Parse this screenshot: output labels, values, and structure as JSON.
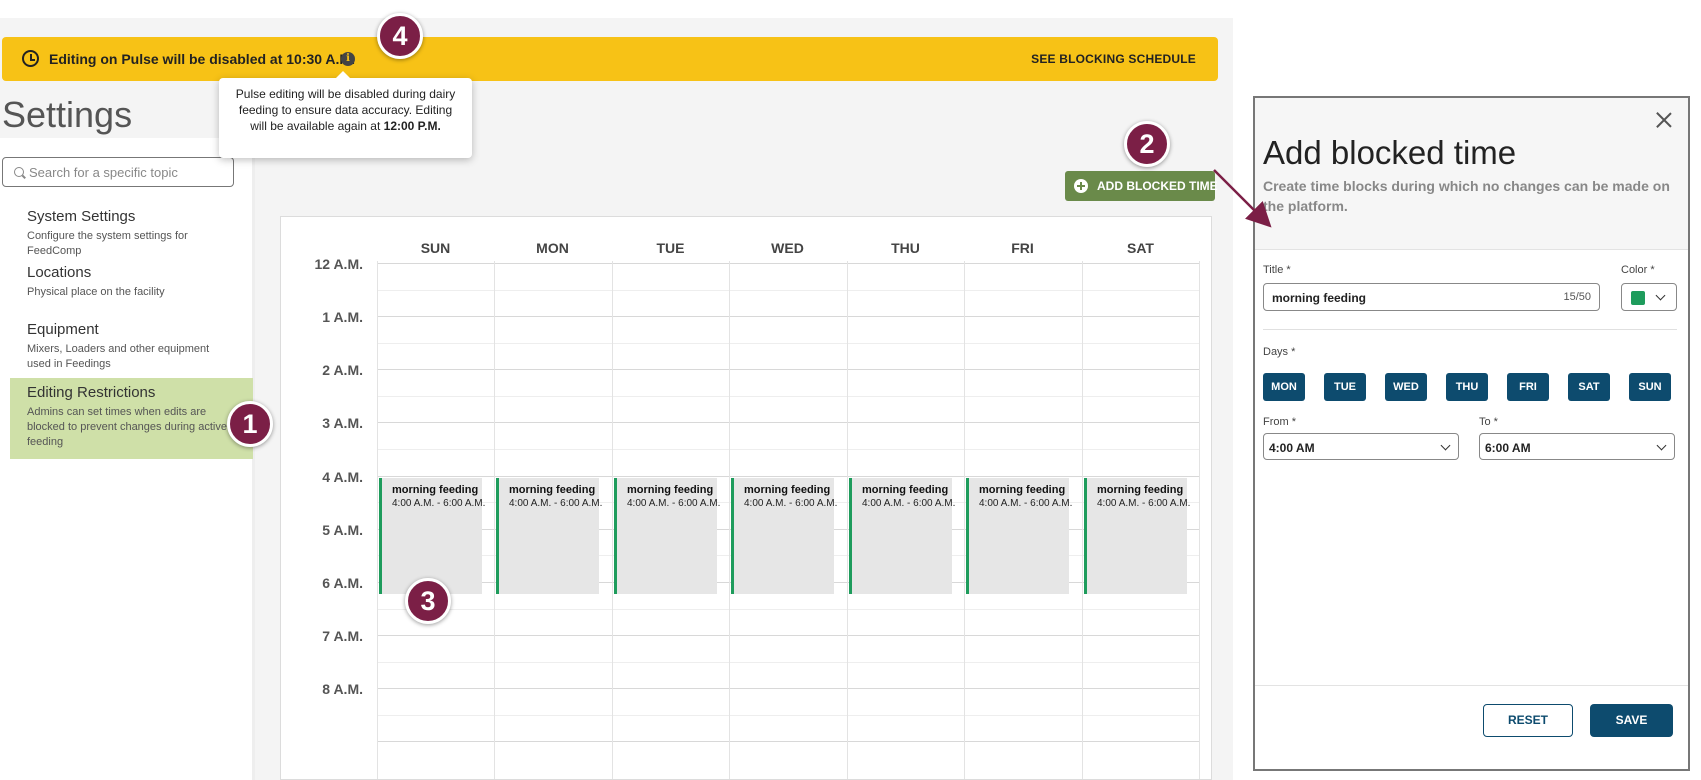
{
  "banner": {
    "text": "Editing on Pulse will be disabled at 10:30 A.M.",
    "info_icon": "i",
    "link": "SEE BLOCKING SCHEDULE",
    "color": "#f7c216"
  },
  "page_title": "Settings",
  "tooltip": {
    "line1": "Pulse editing will be disabled during dairy feeding to ensure data accuracy. Editing will be available again at",
    "time": "12:00 P.M."
  },
  "sidebar": {
    "search_placeholder": "Search for a specific topic",
    "items": [
      {
        "title": "System Settings",
        "desc": "Configure the system settings for FeedComp"
      },
      {
        "title": "Locations",
        "desc": "Physical place on the facility"
      },
      {
        "title": "Equipment",
        "desc": "Mixers, Loaders and other equipment used in Feedings"
      },
      {
        "title": "Editing Restrictions",
        "desc": "Admins can set times when edits are blocked to prevent changes during active feeding",
        "active": true
      }
    ]
  },
  "calendar": {
    "add_button": "ADD BLOCKED TIME",
    "days": [
      "SUN",
      "MON",
      "TUE",
      "WED",
      "THU",
      "FRI",
      "SAT"
    ],
    "times": [
      "12 A.M.",
      "1 A.M.",
      "2 A.M.",
      "3 A.M.",
      "4 A.M.",
      "5 A.M.",
      "6 A.M.",
      "7 A.M.",
      "8 A.M."
    ],
    "event": {
      "title": "morning feeding",
      "hours": "4:00 A.M. - 6:00 A.M."
    }
  },
  "panel": {
    "title": "Add blocked time",
    "subtitle": "Create time blocks during which no changes can be made on the platform.",
    "title_label": "Title *",
    "title_value": "morning feeding",
    "title_count": "15/50",
    "color_label": "Color *",
    "color_value": "#1e9c5c",
    "days_label": "Days *",
    "days": [
      "MON",
      "TUE",
      "WED",
      "THU",
      "FRI",
      "SAT",
      "SUN"
    ],
    "from_label": "From *",
    "from_value": "4:00 AM",
    "to_label": "To *",
    "to_value": "6:00 AM",
    "reset": "RESET",
    "save": "SAVE"
  },
  "annotations": [
    "1",
    "2",
    "3",
    "4"
  ]
}
